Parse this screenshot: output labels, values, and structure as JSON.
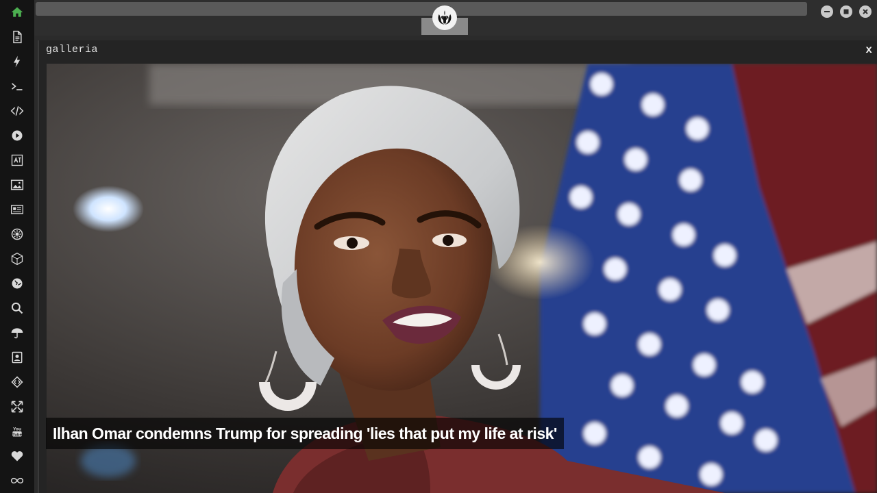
{
  "panel": {
    "title": "galleria",
    "close_label": "x"
  },
  "caption": "Ilhan Omar condemns Trump for spreading 'lies that put my life at risk'",
  "sidebar": {
    "icons": [
      "home-icon",
      "document-icon",
      "bolt-icon",
      "terminal-icon",
      "code-icon",
      "play-icon",
      "translate-icon",
      "image-icon",
      "news-icon",
      "settings-icon",
      "cube-icon",
      "globe-icon",
      "search-icon",
      "umbrella-icon",
      "contacts-icon",
      "code-tags-icon",
      "expand-icon",
      "youtube-icon",
      "heart-icon",
      "infinity-icon"
    ]
  },
  "window_controls": [
    "minimize",
    "maximize",
    "close"
  ],
  "colors": {
    "home_icon": "#4caf50",
    "sidebar_icon": "#d9d9d9"
  }
}
